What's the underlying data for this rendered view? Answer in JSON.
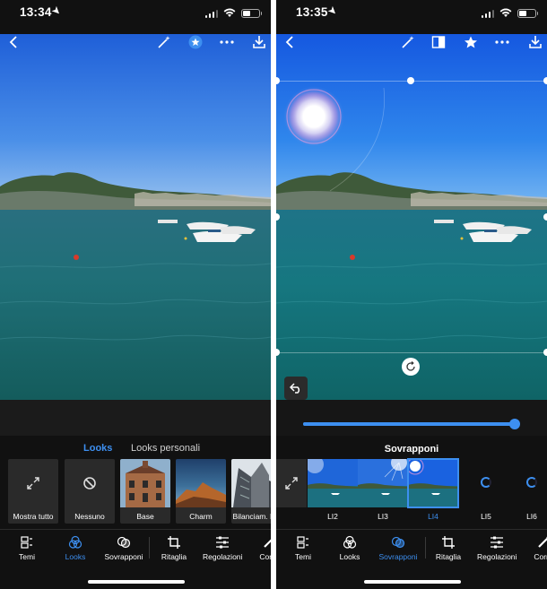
{
  "left": {
    "status": {
      "time": "13:34"
    },
    "tabs": {
      "active": "Looks",
      "inactive": "Looks personali"
    },
    "presets": [
      {
        "label": "Mostra tutto",
        "icon": "expand-icon"
      },
      {
        "label": "Nessuno",
        "icon": "none-icon"
      },
      {
        "label": "Base",
        "icon": ""
      },
      {
        "label": "Charm",
        "icon": ""
      },
      {
        "label": "Bilanciam. bia",
        "icon": ""
      }
    ],
    "nav": [
      {
        "label": "Temi",
        "icon": "themes-icon",
        "active": false
      },
      {
        "label": "Looks",
        "icon": "looks-icon",
        "active": true
      },
      {
        "label": "Sovrapponi",
        "icon": "overlay-icon",
        "active": false
      },
      {
        "label": "Ritaglia",
        "icon": "crop-icon",
        "active": false
      },
      {
        "label": "Regolazioni",
        "icon": "sliders-icon",
        "active": false
      },
      {
        "label": "Corre",
        "icon": "brush-icon",
        "active": false
      }
    ]
  },
  "right": {
    "status": {
      "time": "13:35"
    },
    "overlay_title": "Sovrapponi",
    "slider": {
      "value": 1.0
    },
    "overlays": [
      {
        "label": "",
        "icon": "expand-icon"
      },
      {
        "label": "LI2",
        "icon": ""
      },
      {
        "label": "LI3",
        "icon": ""
      },
      {
        "label": "LI4",
        "icon": "",
        "selected": true
      },
      {
        "label": "LI5",
        "icon": "loading-icon"
      },
      {
        "label": "LI6",
        "icon": "loading-icon"
      }
    ],
    "nav": [
      {
        "label": "Temi",
        "icon": "themes-icon",
        "active": false
      },
      {
        "label": "Looks",
        "icon": "looks-icon",
        "active": false
      },
      {
        "label": "Sovrapponi",
        "icon": "overlay-icon",
        "active": true
      },
      {
        "label": "Ritaglia",
        "icon": "crop-icon",
        "active": false
      },
      {
        "label": "Regolazioni",
        "icon": "sliders-icon",
        "active": false
      },
      {
        "label": "Corre",
        "icon": "brush-icon",
        "active": false
      }
    ]
  },
  "colors": {
    "accent": "#3d8ff0",
    "background": "#111111"
  }
}
